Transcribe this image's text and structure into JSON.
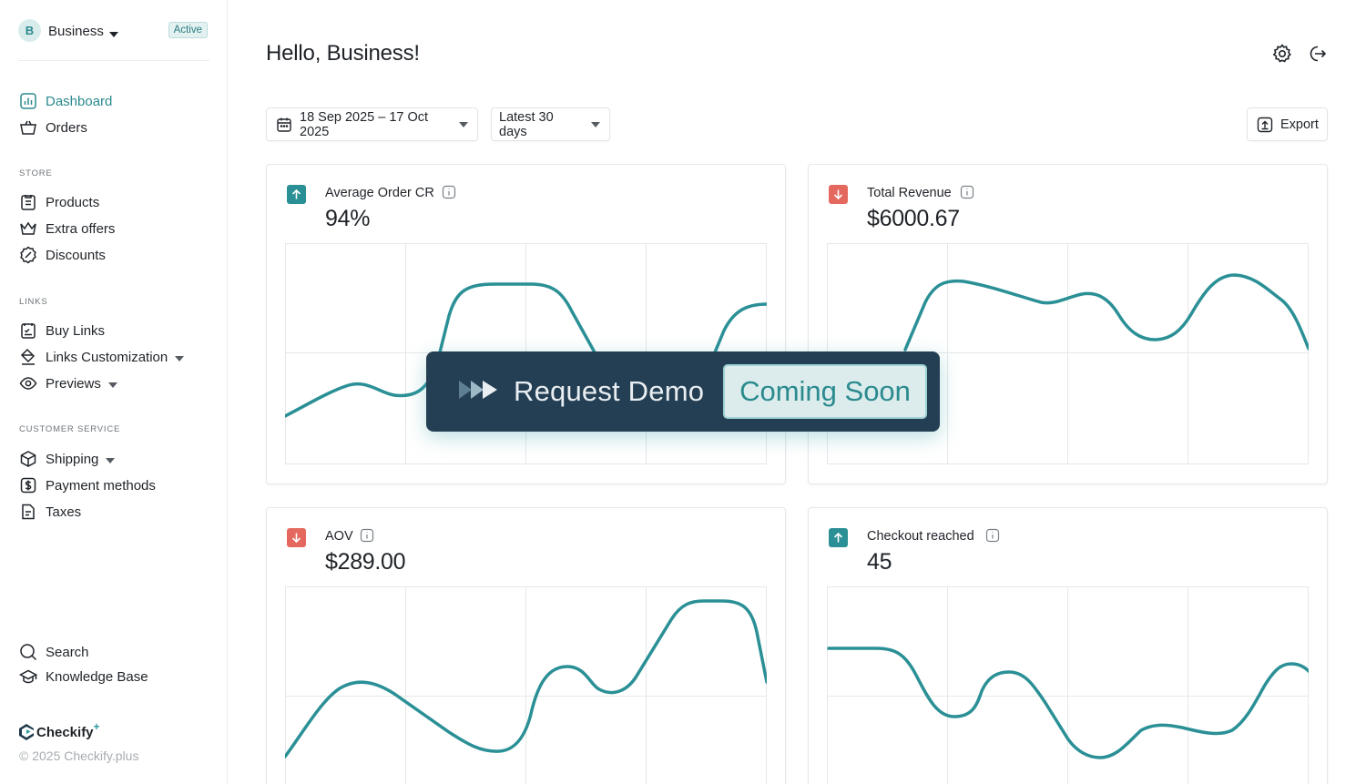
{
  "account": {
    "initial": "B",
    "name": "Business",
    "status": "Active"
  },
  "nav": {
    "main": [
      {
        "label": "Dashboard",
        "icon": "chart-icon",
        "active": true
      },
      {
        "label": "Orders",
        "icon": "basket-icon"
      }
    ],
    "store": {
      "label": "STORE",
      "items": [
        {
          "label": "Products",
          "icon": "clipboard-icon"
        },
        {
          "label": "Extra offers",
          "icon": "crown-icon"
        },
        {
          "label": "Discounts",
          "icon": "discount-badge-icon"
        }
      ]
    },
    "links": {
      "label": "LINKS",
      "items": [
        {
          "label": "Buy Links",
          "icon": "calendar-list-icon"
        },
        {
          "label": "Links Customization",
          "icon": "paint-bucket-icon"
        },
        {
          "label": "Previews",
          "icon": "eye-icon"
        }
      ]
    },
    "customer_service": {
      "label": "CUSTOMER SERVICE",
      "items": [
        {
          "label": "Shipping",
          "icon": "box-icon"
        },
        {
          "label": "Payment methods",
          "icon": "dollar-icon"
        },
        {
          "label": "Taxes",
          "icon": "document-icon"
        }
      ]
    },
    "bottom": [
      {
        "label": "Search",
        "icon": "search-icon"
      },
      {
        "label": "Knowledge Base",
        "icon": "graduation-cap-icon"
      }
    ]
  },
  "brand": {
    "name": "Checkify",
    "plus": "+",
    "copyright": "© 2025 Checkify.plus"
  },
  "header": {
    "greeting": "Hello, Business!"
  },
  "filters": {
    "date_range": "18 Sep 2025 – 17 Oct 2025",
    "period": "Latest 30 days",
    "export_label": "Export"
  },
  "colors": {
    "accent": "#2a9096",
    "trend_up": "#2a9096",
    "trend_down": "#e4685e",
    "overlay_bg": "#243f53"
  },
  "metrics": [
    {
      "label": "Average Order CR",
      "value": "94%",
      "trend": "up"
    },
    {
      "label": "Total Revenue",
      "value": "$6000.67",
      "trend": "down"
    },
    {
      "label": "AOV",
      "value": "$289.00",
      "trend": "down"
    },
    {
      "label": "Checkout reached",
      "value": "45",
      "trend": "up"
    }
  ],
  "demo": {
    "label": "Request Demo",
    "badge": "Coming Soon"
  }
}
